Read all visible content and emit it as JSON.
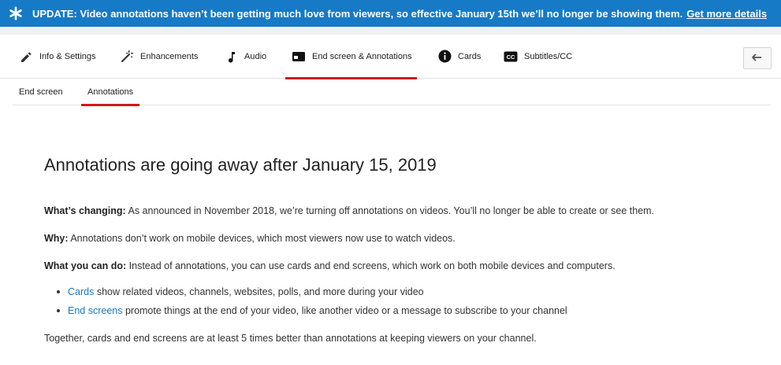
{
  "banner": {
    "text": "UPDATE: Video annotations haven’t been getting much love from viewers, so effective January 15th we’ll no longer be showing them.",
    "link": "Get more details",
    "color": "#167ac6"
  },
  "tabs": [
    {
      "label": "Info & Settings",
      "icon": "pencil-icon"
    },
    {
      "label": "Enhancements",
      "icon": "magic-wand-icon"
    },
    {
      "label": "Audio",
      "icon": "music-note-icon"
    },
    {
      "label": "End screen & Annotations",
      "icon": "end-screen-icon",
      "active": true
    },
    {
      "label": "Cards",
      "icon": "info-icon"
    },
    {
      "label": "Subtitles/CC",
      "icon": "cc-icon"
    }
  ],
  "subtabs": [
    {
      "label": "End screen"
    },
    {
      "label": "Annotations",
      "active": true
    }
  ],
  "accent_color": "#cc181e",
  "content": {
    "title": "Annotations are going away after January 15, 2019",
    "changing_label": "What’s changing:",
    "changing_text": " As announced in November 2018, we’re turning off annotations on videos. You’ll no longer be able to create or see them.",
    "why_label": "Why:",
    "why_text": " Annotations don’t work on mobile devices, which most viewers now use to watch videos.",
    "cando_label": "What you can do:",
    "cando_text": " Instead of annotations, you can use cards and end screens, which work on both mobile devices and computers.",
    "bullets": [
      {
        "link": "Cards",
        "text": " show related videos, channels, websites, polls, and more during your video"
      },
      {
        "link": "End screens",
        "text": " promote things at the end of your video, like another video or a message to subscribe to your channel"
      }
    ],
    "closing": "Together, cards and end screens are at least 5 times better than annotations at keeping viewers on your channel."
  }
}
